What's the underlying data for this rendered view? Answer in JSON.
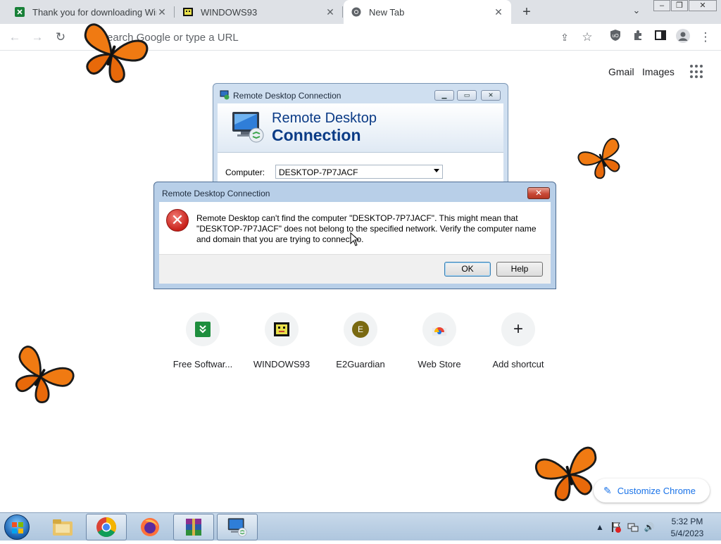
{
  "browser": {
    "tabs": [
      {
        "title": "Thank you for downloading WinRAR",
        "icon": "spreadsheet-icon",
        "active": false
      },
      {
        "title": "WINDOWS93",
        "icon": "windows93-icon",
        "active": false
      },
      {
        "title": "New Tab",
        "icon": "chrome-icon",
        "active": true
      }
    ],
    "omnibox_placeholder": "Search Google or type a URL"
  },
  "ntp": {
    "gmail": "Gmail",
    "images": "Images",
    "shortcuts": [
      {
        "label": "Free Softwar...",
        "icon": "freesoftware-icon"
      },
      {
        "label": "WINDOWS93",
        "icon": "windows93-icon"
      },
      {
        "label": "E2Guardian",
        "icon": "e2guardian-icon",
        "letter": "E"
      },
      {
        "label": "Web Store",
        "icon": "webstore-icon"
      },
      {
        "label": "Add shortcut",
        "icon": "plus-icon"
      }
    ],
    "customize_label": "Customize Chrome"
  },
  "rdc": {
    "title": "Remote Desktop Connection",
    "banner_line1": "Remote Desktop",
    "banner_line2": "Connection",
    "computer_label": "Computer:",
    "computer_value": "DESKTOP-7P7JACF"
  },
  "error_dialog": {
    "title": "Remote Desktop Connection",
    "message": "Remote Desktop can't find the computer \"DESKTOP-7P7JACF\". This might mean that \"DESKTOP-7P7JACF\" does not belong to the specified network.  Verify the computer name and domain that you are trying to connect to.",
    "ok": "OK",
    "help": "Help"
  },
  "taskbar": {
    "time": "5:32 PM",
    "date": "5/4/2023"
  },
  "colors": {
    "accent": "#1a73e8",
    "butterfly_orange": "#f07a12"
  }
}
